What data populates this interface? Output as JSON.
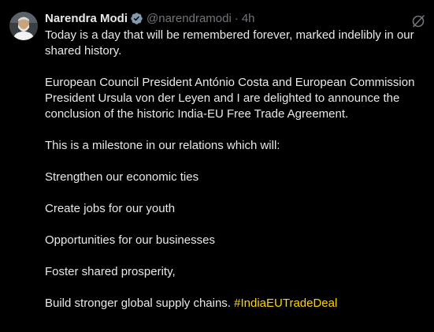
{
  "author": {
    "display_name": "Narendra Modi",
    "handle": "@narendramodi",
    "separator": "·",
    "time": "4h",
    "avatar_icon": "profile-photo",
    "verified_icon": "verified-badge-icon"
  },
  "tweet": {
    "paragraphs": [
      "Today is a day that will be remembered forever, marked indelibly in our shared history.",
      "European Council President António Costa and European Commission President Ursula von der Leyen and I are delighted to announce the conclusion of the historic India-EU Free Trade Agreement.",
      "This is a milestone in our relations which will:",
      "Strengthen our economic ties",
      "Create jobs for our youth",
      "Opportunities for our businesses",
      "Foster shared prosperity,"
    ],
    "last_line_text": "Build stronger global supply chains. ",
    "hashtag": "#IndiaEUTradeDeal"
  },
  "colors": {
    "background": "#000000",
    "text": "#e7e9ea",
    "muted": "#71767b",
    "hashtag": "#ffd400",
    "verified": "#829aab"
  },
  "icons": {
    "grok": "grok-icon"
  }
}
